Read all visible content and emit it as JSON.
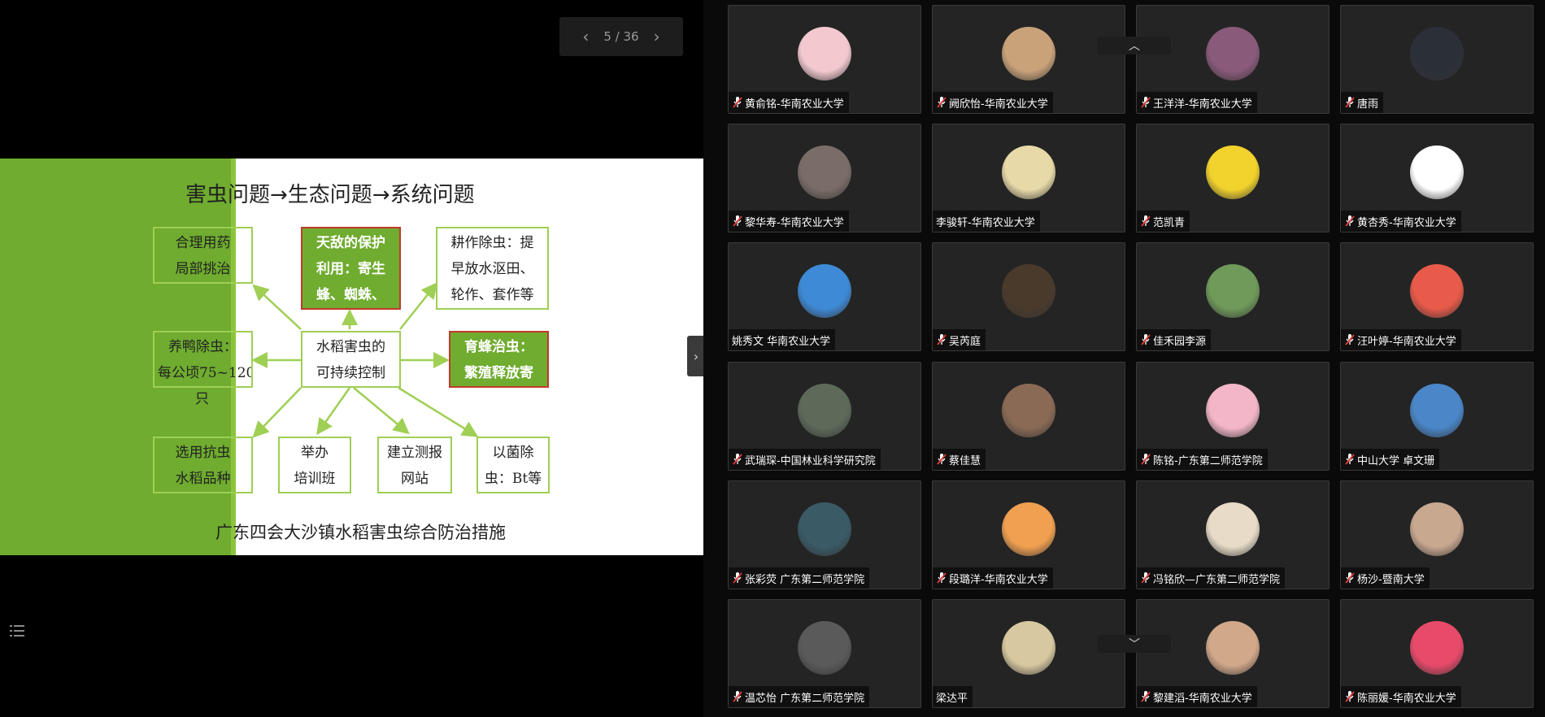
{
  "pager": {
    "label": "5 / 36",
    "prev": "‹",
    "next": "›"
  },
  "slide": {
    "title": "害虫问题→生态问题→系统问题",
    "footer": "广东四会大沙镇水稻害虫综合防治措施",
    "center": [
      "水稻害虫的",
      "可持续控制"
    ],
    "boxes": {
      "top_left": [
        "合理用药",
        "局部挑治"
      ],
      "top_mid": [
        "天敌的保护",
        "利用：寄生",
        "蜂、蜘蛛、"
      ],
      "top_right": [
        "耕作除虫：提",
        "早放水沤田、",
        "轮作、套作等"
      ],
      "mid_left": [
        "养鸭除虫：",
        "每公顷75~120",
        "只"
      ],
      "mid_right": [
        "育蜂治虫：",
        "繁殖释放寄"
      ],
      "bot_left": [
        "选用抗虫",
        "水稻品种"
      ],
      "bot_1": [
        "举办",
        "培训班"
      ],
      "bot_2": [
        "建立测报",
        "网站"
      ],
      "bot_3": [
        "以菌除",
        "虫：Bt等"
      ]
    }
  },
  "handle_label": "›",
  "scroll_up": "︿",
  "scroll_down": "﹀",
  "participants": [
    {
      "name": "黄俞铭-华南农业大学",
      "muted": true,
      "color": "#f3c9cf"
    },
    {
      "name": "阙欣怡-华南农业大学",
      "muted": true,
      "color": "#c9a27a"
    },
    {
      "name": "王洋洋-华南农业大学",
      "muted": true,
      "color": "#8a5a7a"
    },
    {
      "name": "唐雨",
      "muted": true,
      "color": "#2b2f38"
    },
    {
      "name": "黎华寿-华南农业大学",
      "muted": true,
      "color": "#7a6d68"
    },
    {
      "name": "李骏轩-华南农业大学",
      "muted": false,
      "color": "#e7d9a8"
    },
    {
      "name": "范凯青",
      "muted": true,
      "color": "#f2d22c"
    },
    {
      "name": "黄杏秀-华南农业大学",
      "muted": true,
      "color": "#ffffff"
    },
    {
      "name": "姚秀文 华南农业大学",
      "muted": false,
      "color": "#3e8ad6"
    },
    {
      "name": "吴芮庭",
      "muted": true,
      "color": "#4a3a2c"
    },
    {
      "name": "佳禾园李源",
      "muted": true,
      "color": "#6f9a5a"
    },
    {
      "name": "汪叶婷-华南农业大学",
      "muted": true,
      "color": "#e85a4a"
    },
    {
      "name": "武瑞琛-中国林业科学研究院",
      "muted": true,
      "color": "#5d6a5a"
    },
    {
      "name": "蔡佳慧",
      "muted": true,
      "color": "#8a6a55"
    },
    {
      "name": "陈铭-广东第二师范学院",
      "muted": true,
      "color": "#f3b6c8"
    },
    {
      "name": "中山大学 卓文珊",
      "muted": true,
      "color": "#4a86c8"
    },
    {
      "name": "张彩荧 广东第二师范学院",
      "muted": true,
      "color": "#3a5a66"
    },
    {
      "name": "段璐洋-华南农业大学",
      "muted": true,
      "color": "#f0a050"
    },
    {
      "name": "冯铭欣—广东第二师范学院",
      "muted": true,
      "color": "#e8dcc8"
    },
    {
      "name": "杨沙-暨南大学",
      "muted": true,
      "color": "#c9a890"
    },
    {
      "name": "温芯怡 广东第二师范学院",
      "muted": true,
      "color": "#5a5a5a"
    },
    {
      "name": "梁达平",
      "muted": false,
      "color": "#d8c8a0"
    },
    {
      "name": "黎建滔-华南农业大学",
      "muted": true,
      "color": "#d2a88a"
    },
    {
      "name": "陈丽媛-华南农业大学",
      "muted": true,
      "color": "#e84a6a"
    }
  ]
}
